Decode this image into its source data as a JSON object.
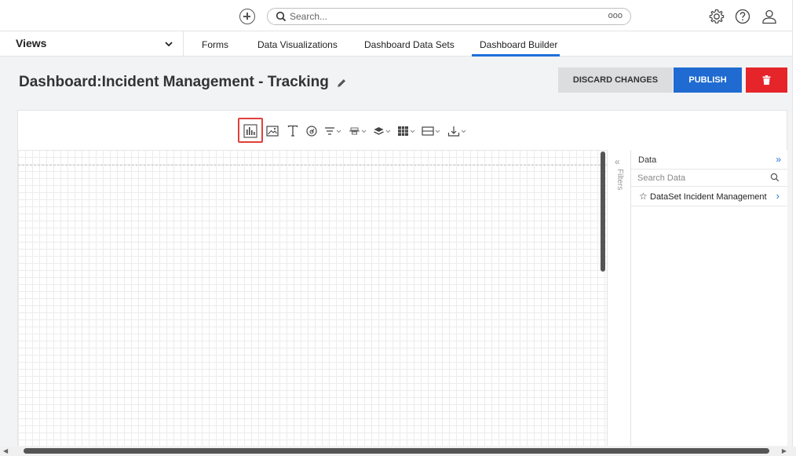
{
  "topbar": {
    "search_placeholder": "Search...",
    "search_more": "ooo",
    "icons": [
      "plus-circle-icon",
      "search-icon",
      "gear-icon",
      "help-icon",
      "user-icon"
    ]
  },
  "nav": {
    "views_label": "Views",
    "tabs": [
      {
        "label": "Forms"
      },
      {
        "label": "Data Visualizations"
      },
      {
        "label": "Dashboard Data Sets"
      },
      {
        "label": "Dashboard Builder",
        "active": true
      }
    ]
  },
  "header": {
    "title": "Dashboard:Incident Management - Tracking",
    "discard_label": "DISCARD CHANGES",
    "publish_label": "PUBLISH"
  },
  "toolbar": {
    "tools": [
      "chart-icon",
      "image-icon",
      "text-icon",
      "gauge-icon",
      "filter-icon",
      "align-icon",
      "layers-icon",
      "table-icon",
      "frame-icon",
      "download-icon"
    ],
    "highlighted_tool": "chart-icon"
  },
  "filters": {
    "label": "Filters"
  },
  "data_panel": {
    "title": "Data",
    "search_placeholder": "Search Data",
    "items": [
      {
        "label": "DataSet Incident Management"
      }
    ]
  },
  "colors": {
    "accent": "#1e6fd9",
    "publish": "#1f6bd1",
    "delete": "#e5252a",
    "highlight": "#e0403c"
  }
}
